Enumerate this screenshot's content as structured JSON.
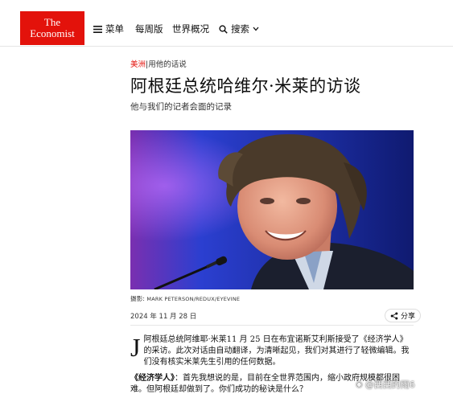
{
  "brand": {
    "line1": "The",
    "line2": "Economist"
  },
  "nav": {
    "menu_label": "菜单",
    "weekly_label": "每周版",
    "world_label": "世界概况",
    "search_label": "搜索"
  },
  "article": {
    "kicker_section": "美洲",
    "kicker_sep": "|",
    "kicker_topic": "用他的话说",
    "headline": "阿根廷总统哈维尔·米莱的访谈",
    "subheadline": "他与我们的记者会面的记录",
    "image_credit_label": "摄影:",
    "image_credit": "MARK PETERSON/REDUX/EYEVINE",
    "date": "2024 年 11 月 28 日",
    "share_label": "分享",
    "dropcap": "J",
    "intro_paragraph": "阿根廷总统阿维耶·米莱11 月 25 日在布宜诺斯艾利斯接受了《经济学人》的采访。此次对话由自动翻译，为清晰起见，我们对其进行了轻微编辑。我们没有核实米莱先生引用的任何数据。",
    "q1_speaker": "《经济学人》",
    "q1_text": "：首先我想说的是，目前在全世界范围内，缩小政府规模都很困难。但阿根廷却做到了。你们成功的秘诀是什么？"
  },
  "watermark": {
    "text": "@西西的雨6"
  },
  "colors": {
    "brand_red": "#e3120b",
    "hero_blue": "#1b2a8a"
  }
}
